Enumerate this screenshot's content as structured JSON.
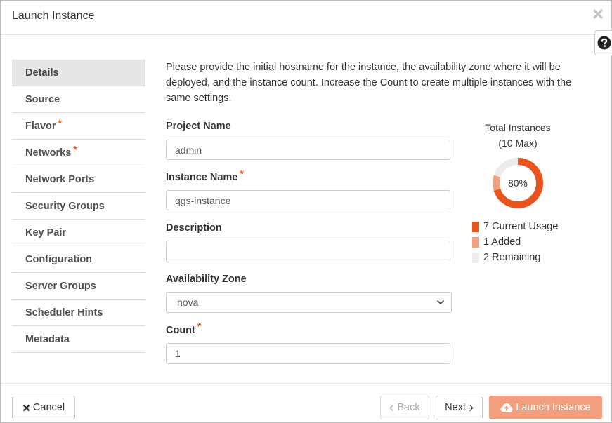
{
  "header": {
    "title": "Launch Instance"
  },
  "nav": {
    "items": [
      {
        "label": "Details",
        "required": false,
        "active": true
      },
      {
        "label": "Source",
        "required": false
      },
      {
        "label": "Flavor",
        "required": true
      },
      {
        "label": "Networks",
        "required": true
      },
      {
        "label": "Network Ports",
        "required": false
      },
      {
        "label": "Security Groups",
        "required": false
      },
      {
        "label": "Key Pair",
        "required": false
      },
      {
        "label": "Configuration",
        "required": false
      },
      {
        "label": "Server Groups",
        "required": false
      },
      {
        "label": "Scheduler Hints",
        "required": false
      },
      {
        "label": "Metadata",
        "required": false
      }
    ],
    "required_mark": "*"
  },
  "details": {
    "intro": "Please provide the initial hostname for the instance, the availability zone where it will be deployed, and the instance count. Increase the Count to create multiple instances with the same settings.",
    "project_name": {
      "label": "Project Name",
      "value": "admin"
    },
    "instance_name": {
      "label": "Instance Name",
      "value": "qgs-instance"
    },
    "description": {
      "label": "Description",
      "value": ""
    },
    "availability_zone": {
      "label": "Availability Zone",
      "value": "nova"
    },
    "count": {
      "label": "Count",
      "value": "1"
    }
  },
  "instances_chart": {
    "title_line1": "Total Instances",
    "title_line2": "(10 Max)",
    "center_label": "80%",
    "max": 10,
    "current_usage": 7,
    "added": 1,
    "remaining": 2,
    "legend": [
      {
        "label": "7 Current Usage",
        "color": "#e8541e"
      },
      {
        "label": "1 Added",
        "color": "#f29f7f"
      },
      {
        "label": "2 Remaining",
        "color": "#ececec"
      }
    ]
  },
  "footer": {
    "cancel_label": "Cancel",
    "back_label": "Back",
    "next_label": "Next",
    "launch_label": "Launch Instance"
  },
  "colors": {
    "accent": "#e8541e",
    "accent_light": "#f29f7f",
    "remaining": "#ececec"
  }
}
